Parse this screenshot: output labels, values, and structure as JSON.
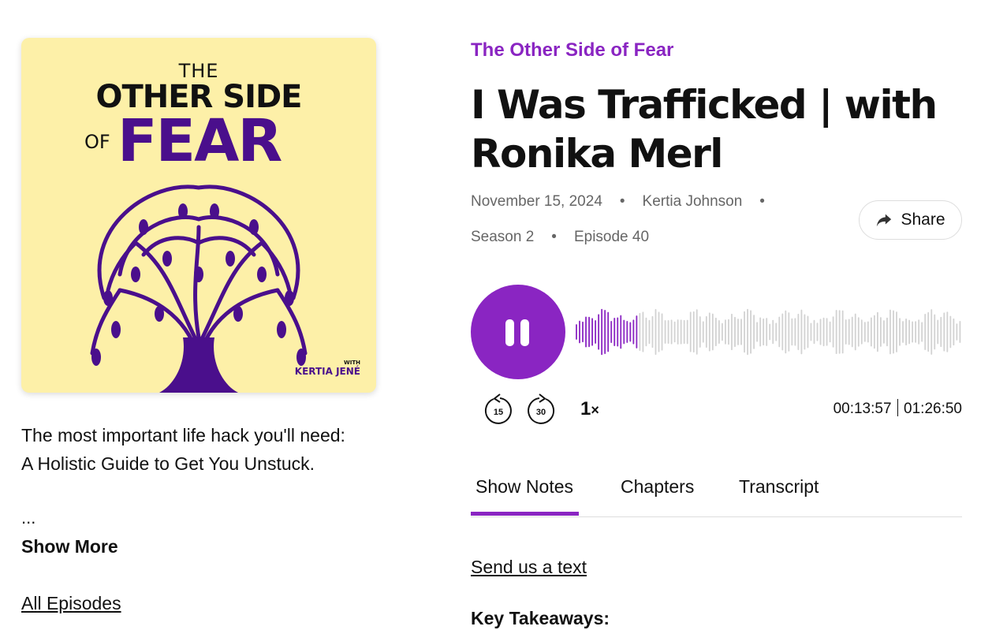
{
  "cover": {
    "line1": "THE",
    "line2": "OTHER SIDE",
    "line3_small": "OF",
    "line3_big": "FEAR",
    "with_label": "WITH",
    "host_name": "KERTIA JENÉ",
    "bg_color": "#fdf0a8",
    "brand_color": "#4a0f8c"
  },
  "sidebar": {
    "description": "The most important life hack you'll need: A Holistic Guide to Get You Unstuck.",
    "ellipsis": "...",
    "show_more": "Show More",
    "all_episodes": "All Episodes"
  },
  "episode": {
    "podcast_title": "The Other Side of Fear",
    "title": "I Was Trafficked | with Ronika Merl",
    "date": "November 15, 2024",
    "author": "Kertia Johnson",
    "season": "Season 2",
    "episode": "Episode 40"
  },
  "share": {
    "label": "Share",
    "icon": "share-arrow-icon"
  },
  "player": {
    "state": "playing",
    "skip_back_label": "15",
    "skip_fwd_label": "30",
    "speed": "1",
    "speed_suffix": "×",
    "current_time": "00:13:57",
    "duration": "01:26:50",
    "progress_fraction": 0.16,
    "accent": "#8a25c2",
    "wave_played_color": "#8a25c2",
    "wave_unplayed_color": "#d2d2d2"
  },
  "tabs": [
    {
      "label": "Show Notes",
      "active": true
    },
    {
      "label": "Chapters",
      "active": false
    },
    {
      "label": "Transcript",
      "active": false
    }
  ],
  "notes": {
    "send_text": "Send us a text",
    "key_takeaways": "Key Takeaways:"
  }
}
